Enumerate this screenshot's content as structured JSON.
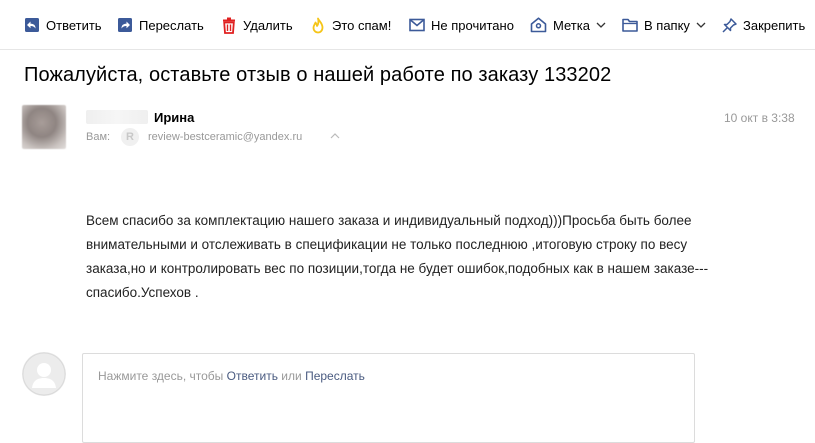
{
  "toolbar": {
    "reply": "Ответить",
    "forward": "Переслать",
    "delete": "Удалить",
    "spam": "Это спам!",
    "unread": "Не прочитано",
    "label": "Метка",
    "folder": "В папку",
    "pin": "Закрепить",
    "icons": {
      "reply": "reply-icon",
      "forward": "forward-icon",
      "delete": "trash-icon",
      "spam": "thumb-down-icon",
      "unread": "envelope-icon",
      "label": "tag-icon",
      "folder": "folder-icon",
      "pin": "pin-icon"
    },
    "colors": {
      "icon_blue": "#3c5a99",
      "delete_red": "#e02020",
      "spam_yellow": "#f5c518"
    }
  },
  "message": {
    "subject": "Пожалуйста, оставьте отзыв о нашей работе по заказу 133202",
    "from_name": "Ирина",
    "to_label": "Вам:",
    "to_badge": "R",
    "to_email": "review-bestceramic@yandex.ru",
    "date": "10 окт в 3:38",
    "body_lines": [
      "Всем спасибо за комплектацию нашего заказа и индивидуальный подход)))Просьба быть более",
      "внимательными и отслеживать в спецификации не только последнюю ,итоговую строку по весу",
      "заказа,но и контролировать вес по позиции,тогда не будет ошибок,подобных как в нашем заказе---",
      "спасибо.Успехов ."
    ]
  },
  "reply": {
    "hint_prefix": "Нажмите здесь, чтобы",
    "reply_link": "Ответить",
    "hint_or": "или",
    "forward_link": "Переслать"
  }
}
